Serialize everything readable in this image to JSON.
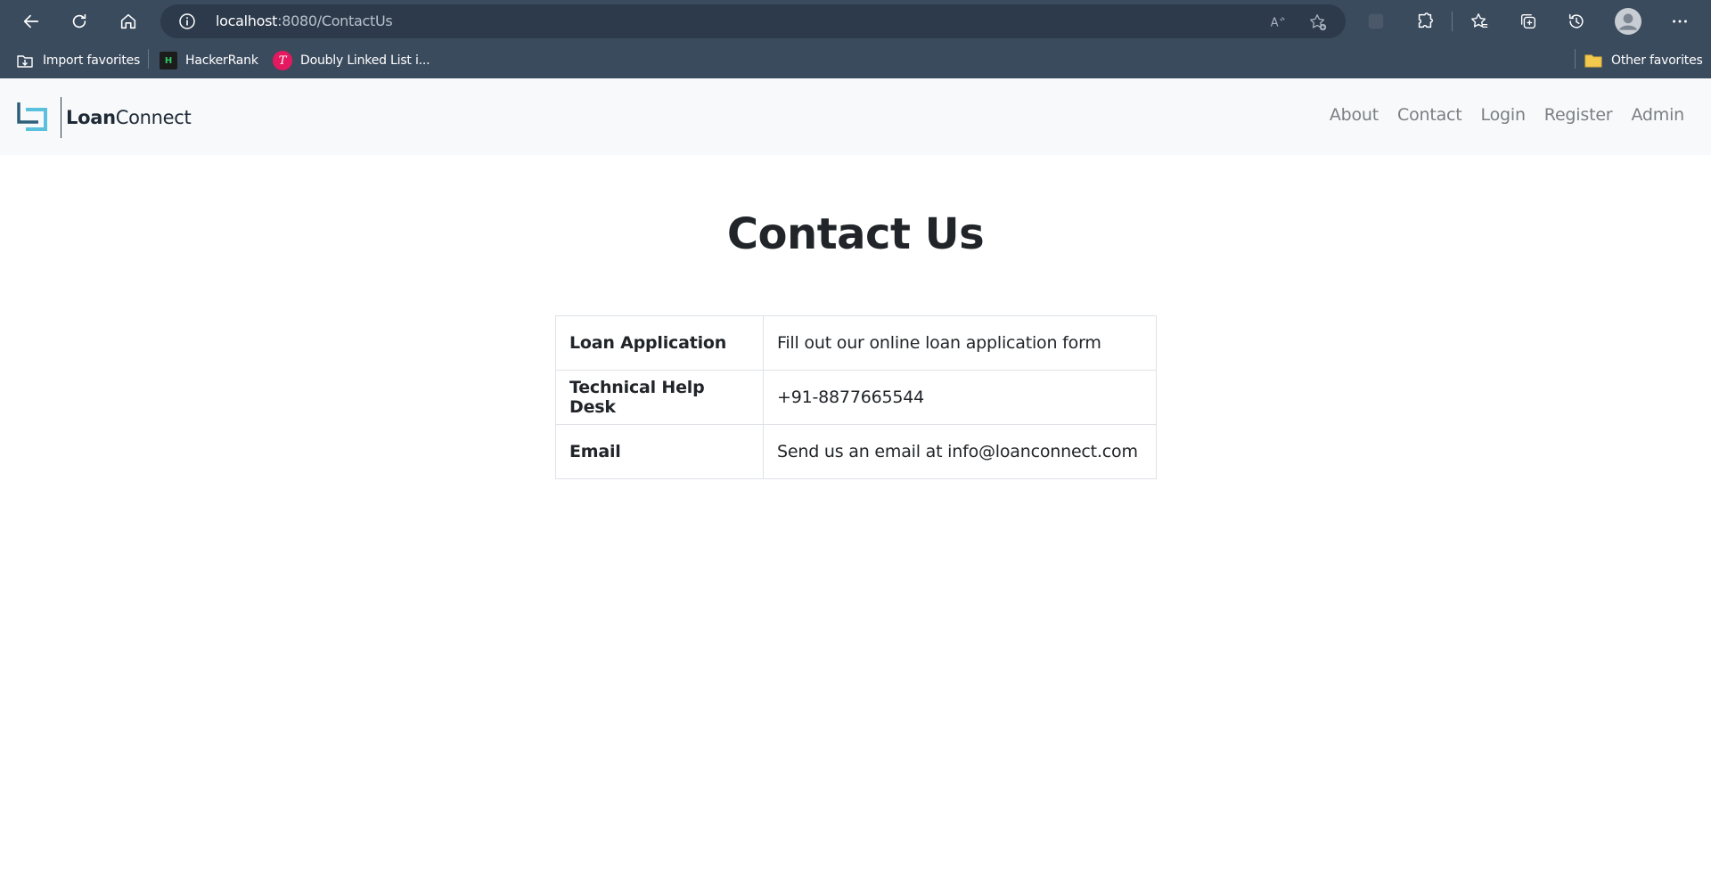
{
  "browser": {
    "url_host": "localhost",
    "url_rest": ":8080/ContactUs",
    "favorites": [
      {
        "label": "Import favorites"
      },
      {
        "label": "HackerRank",
        "icon_text": "H"
      },
      {
        "label": "Doubly Linked List i...",
        "icon_text": "T"
      }
    ],
    "other_favorites": "Other favorites"
  },
  "site": {
    "brand_bold": "Loan",
    "brand_light": "Connect",
    "nav": [
      "About",
      "Contact",
      "Login",
      "Register",
      "Admin"
    ]
  },
  "page": {
    "title": "Contact Us",
    "rows": [
      {
        "label": "Loan Application",
        "value": "Fill out our online loan application form"
      },
      {
        "label": "Technical Help Desk",
        "value": "+91-8877665544"
      },
      {
        "label": "Email",
        "value": "Send us an email at info@loanconnect.com"
      }
    ]
  },
  "colors": {
    "chrome": "#3b4b5e",
    "navbar_bg": "#f8f9fa",
    "logo_teal": "#5bc0de",
    "nav_link": "#7a7f85"
  }
}
